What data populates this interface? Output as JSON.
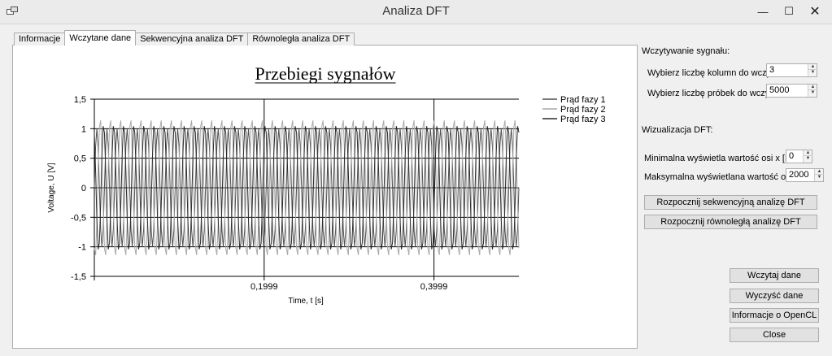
{
  "window": {
    "title": "Analiza DFT",
    "min_glyph": "—",
    "max_glyph": "☐",
    "close_glyph": "✕"
  },
  "tabs": [
    {
      "label": "Informacje",
      "active": false
    },
    {
      "label": "Wczytane dane",
      "active": true
    },
    {
      "label": "Sekwencyjna analiza DFT",
      "active": false
    },
    {
      "label": "Równoległa analiza DFT",
      "active": false
    }
  ],
  "chart_data": {
    "type": "line",
    "title": "Przebiegi sygnałów",
    "xlabel": "Time, t [s]",
    "ylabel": "Voltage, U [V]",
    "ylim": [
      -1.5,
      1.5
    ],
    "yticks": [
      1.5,
      1,
      0.5,
      0,
      -0.5,
      -1,
      -1.5
    ],
    "ytick_labels": [
      "1,5",
      "1",
      "0,5",
      "0",
      "-0,5",
      "-1",
      "-1,5"
    ],
    "xlim": [
      0,
      0.25
    ],
    "xticks": [
      0.1999,
      0.3999
    ],
    "xtick_labels": [
      "0,1999",
      "0,3999"
    ],
    "grid": true,
    "legend_position": "top-right",
    "series": [
      {
        "name": "Prąd fazy 1",
        "color": "#505050",
        "amplitude": 1.0,
        "frequency_hz": 50,
        "phase_deg": 0
      },
      {
        "name": "Prąd fazy 2",
        "color": "#a8a8a8",
        "amplitude": 1.0,
        "frequency_hz": 50,
        "phase_deg": -120
      },
      {
        "name": "Prąd fazy 3",
        "color": "#2a2a2a",
        "amplitude": 1.0,
        "frequency_hz": 50,
        "phase_deg": 120
      }
    ]
  },
  "signal_load": {
    "section_label": "Wczytywanie sygnału:",
    "columns_label": "Wybierz liczbę kolumn do wczytania:",
    "columns_value": "3",
    "samples_label": "Wybierz liczbę próbek do wczytania:",
    "samples_value": "5000"
  },
  "dft_vis": {
    "section_label": "Wizualizacja DFT:",
    "min_label": "Minimalna wyświetla wartość osi x [Hz]:",
    "min_value": "0",
    "max_label": "Maksymalna wyświetlana wartość osi x [Hz]:",
    "max_value": "2000"
  },
  "buttons": {
    "seq": "Rozpocznij sekwencyjną analizę DFT",
    "par": "Rozpocznij równoległą analizę DFT",
    "load": "Wczytaj dane",
    "clear": "Wyczyść dane",
    "opencl": "Informacje o OpenCL",
    "close": "Close"
  }
}
